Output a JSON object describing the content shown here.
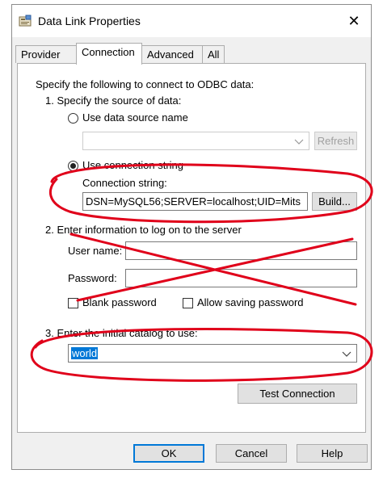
{
  "window": {
    "title": "Data Link Properties",
    "close_glyph": "✕"
  },
  "tabs": [
    {
      "label": "Provider",
      "active": false
    },
    {
      "label": "Connection",
      "active": true
    },
    {
      "label": "Advanced",
      "active": false
    },
    {
      "label": "All",
      "active": false
    }
  ],
  "connection": {
    "intro": "Specify the following to connect to ODBC data:",
    "step1": {
      "label": "1. Specify the source of data:",
      "dsn_option": "Use data source name",
      "dsn_value": "",
      "refresh_label": "Refresh",
      "conn_option": "Use connection string",
      "conn_label": "Connection string:",
      "conn_value": "DSN=MySQL56;SERVER=localhost;UID=Mits",
      "build_label": "Build..."
    },
    "step2": {
      "label": "2. Enter information to log on to the server",
      "username_label": "User name:",
      "username_value": "",
      "password_label": "Password:",
      "password_value": "",
      "blank_password": "Blank password",
      "allow_saving": "Allow saving password"
    },
    "step3": {
      "label": "3. Enter the initial catalog to use:",
      "catalog_value": "world"
    },
    "test_label": "Test Connection"
  },
  "footer": {
    "ok": "OK",
    "cancel": "Cancel",
    "help": "Help"
  },
  "annotation_color": "#e0001a",
  "icons": {
    "app": "data-link-icon",
    "dropdown": "chevron-down-icon"
  }
}
